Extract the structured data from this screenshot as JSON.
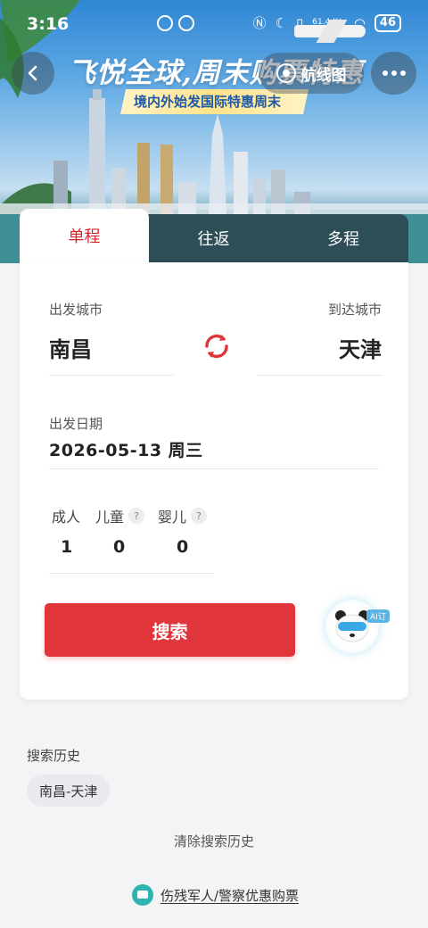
{
  "status_bar": {
    "time": "3:16",
    "speed": "61.4 K/s",
    "battery": "46"
  },
  "header": {
    "banner_title": "飞悦全球,周末购票特惠",
    "banner_subtitle": "境内外始发国际特惠周末",
    "route_map_label": "航线图"
  },
  "tabs": [
    {
      "label": "单程",
      "active": true
    },
    {
      "label": "往返",
      "active": false
    },
    {
      "label": "多程",
      "active": false
    }
  ],
  "form": {
    "depart_label": "出发城市",
    "depart_city": "南昌",
    "arrive_label": "到达城市",
    "arrive_city": "天津",
    "date_label": "出发日期",
    "date_value": "2026-05-13 周三",
    "passengers": [
      {
        "label": "成人",
        "count": "1"
      },
      {
        "label": "儿童",
        "count": "0"
      },
      {
        "label": "婴儿",
        "count": "0"
      }
    ],
    "search_label": "搜索",
    "ai_tag": "AI订"
  },
  "history": {
    "title": "搜索历史",
    "items": [
      "南昌-天津"
    ],
    "clear_label": "清除搜索历史"
  },
  "footer": {
    "discount_label": "伤残军人/警察优惠购票"
  },
  "colors": {
    "accent": "#e0353a",
    "active_tab_text": "#d6242b",
    "banner_ribbon": "#ffe38a"
  }
}
